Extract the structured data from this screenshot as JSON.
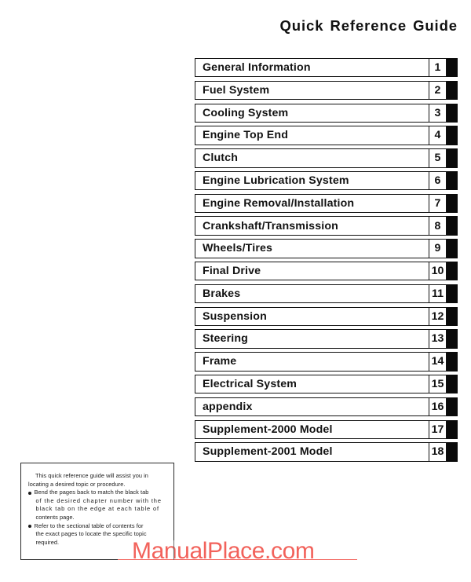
{
  "document": {
    "title": "Quick Reference Guide"
  },
  "chapters": [
    {
      "name": "General Information",
      "number": "1"
    },
    {
      "name": "Fuel System",
      "number": "2"
    },
    {
      "name": "Cooling System",
      "number": "3"
    },
    {
      "name": "Engine Top End",
      "number": "4"
    },
    {
      "name": "Clutch",
      "number": "5"
    },
    {
      "name": "Engine Lubrication System",
      "number": "6"
    },
    {
      "name": "Engine Removal/Installation",
      "number": "7"
    },
    {
      "name": "Crankshaft/Transmission",
      "number": "8"
    },
    {
      "name": "Wheels/Tires",
      "number": "9"
    },
    {
      "name": "Final Drive",
      "number": "10"
    },
    {
      "name": "Brakes",
      "number": "11"
    },
    {
      "name": "Suspension",
      "number": "12"
    },
    {
      "name": "Steering",
      "number": "13"
    },
    {
      "name": "Frame",
      "number": "14"
    },
    {
      "name": "Electrical System",
      "number": "15"
    },
    {
      "name": "appendix",
      "number": "16"
    },
    {
      "name": "Supplement-2000 Model",
      "number": "17"
    },
    {
      "name": "Supplement-2001 Model",
      "number": "18"
    }
  ],
  "note": {
    "intro_line_1": "This quick reference guide will assist you in",
    "intro_line_2": "locating a desired topic or procedure.",
    "bullet_1_line_1": "Bend the pages back to match the black tab",
    "bullet_1_line_2": "of the desired chapter number with the",
    "bullet_1_line_3": "black tab on the edge at each table of",
    "bullet_1_line_4": "contents page.",
    "bullet_2_line_1": "Refer to the sectional table of contents for",
    "bullet_2_line_2": "the exact pages to locate the specific topic",
    "bullet_2_line_3": "required."
  },
  "watermark": {
    "text": "ManualPlace.com",
    "color": "#f2625b"
  },
  "colors": {
    "page_background": "#ffffff",
    "ink": "#111111",
    "tab_black": "#0a0a0a"
  }
}
